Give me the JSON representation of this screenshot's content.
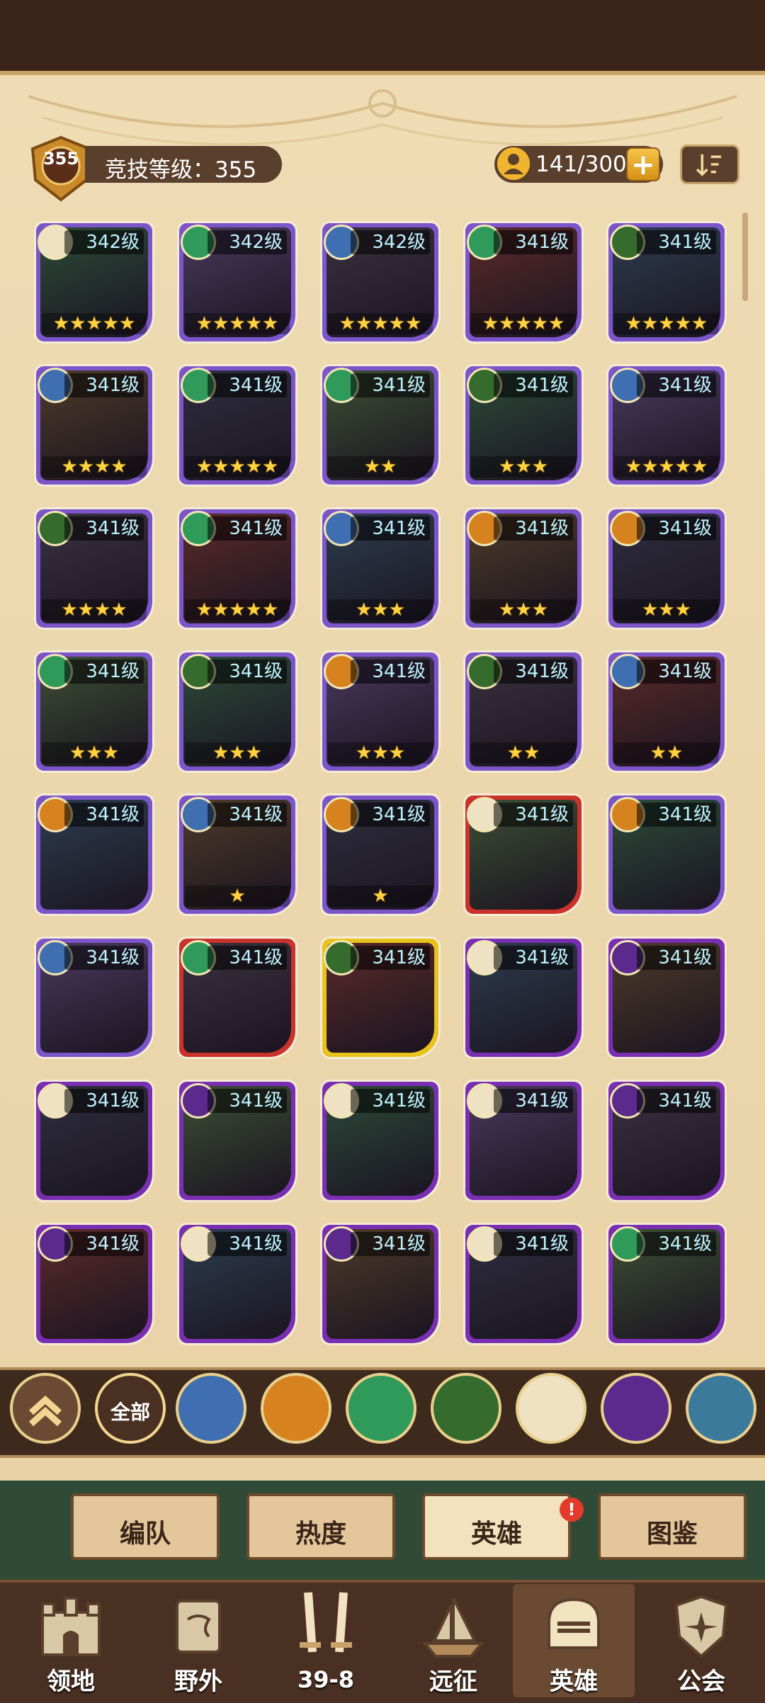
{
  "header": {
    "rank_badge": "355",
    "arena_label": "竞技等级：355",
    "hero_count": "141/300",
    "plus_label": "+"
  },
  "heroes": [
    {
      "level": "342级",
      "stars": "★★★★★",
      "frame": "purple",
      "faction": "celestial"
    },
    {
      "level": "342级",
      "stars": "★★★★★",
      "frame": "purple",
      "faction": "wilder"
    },
    {
      "level": "342级",
      "stars": "★★★★★",
      "frame": "purple",
      "faction": "lightbearer"
    },
    {
      "level": "341级",
      "stars": "★★★★★",
      "frame": "purple",
      "faction": "wilder"
    },
    {
      "level": "341级",
      "stars": "★★★★★",
      "frame": "purple",
      "faction": "graveborn"
    },
    {
      "level": "341级",
      "stars": "★★★★",
      "frame": "purple",
      "faction": "lightbearer"
    },
    {
      "level": "341级",
      "stars": "★★★★★",
      "frame": "purple",
      "faction": "wilder"
    },
    {
      "level": "341级",
      "stars": "★★",
      "frame": "purple",
      "faction": "wilder"
    },
    {
      "level": "341级",
      "stars": "★★★",
      "frame": "purple",
      "faction": "graveborn"
    },
    {
      "level": "341级",
      "stars": "★★★★★",
      "frame": "purple",
      "faction": "lightbearer"
    },
    {
      "level": "341级",
      "stars": "★★★★",
      "frame": "purple",
      "faction": "graveborn"
    },
    {
      "level": "341级",
      "stars": "★★★★★",
      "frame": "purple",
      "faction": "wilder"
    },
    {
      "level": "341级",
      "stars": "★★★",
      "frame": "purple",
      "faction": "lightbearer"
    },
    {
      "level": "341级",
      "stars": "★★★",
      "frame": "purple",
      "faction": "mauler"
    },
    {
      "level": "341级",
      "stars": "★★★",
      "frame": "purple",
      "faction": "mauler"
    },
    {
      "level": "341级",
      "stars": "★★★",
      "frame": "purple",
      "faction": "wilder"
    },
    {
      "level": "341级",
      "stars": "★★★",
      "frame": "purple",
      "faction": "graveborn"
    },
    {
      "level": "341级",
      "stars": "★★★",
      "frame": "purple",
      "faction": "mauler"
    },
    {
      "level": "341级",
      "stars": "★★",
      "frame": "purple",
      "faction": "graveborn"
    },
    {
      "level": "341级",
      "stars": "★★",
      "frame": "purple",
      "faction": "lightbearer"
    },
    {
      "level": "341级",
      "stars": "",
      "frame": "purple",
      "faction": "mauler"
    },
    {
      "level": "341级",
      "stars": "★",
      "frame": "purple",
      "faction": "lightbearer"
    },
    {
      "level": "341级",
      "stars": "★",
      "frame": "purple",
      "faction": "mauler"
    },
    {
      "level": "341级",
      "stars": "",
      "frame": "red",
      "faction": "celestial"
    },
    {
      "level": "341级",
      "stars": "",
      "frame": "purple",
      "faction": "mauler"
    },
    {
      "level": "341级",
      "stars": "",
      "frame": "purple",
      "faction": "lightbearer"
    },
    {
      "level": "341级",
      "stars": "",
      "frame": "red",
      "faction": "wilder"
    },
    {
      "level": "341级",
      "stars": "",
      "frame": "yellow",
      "faction": "graveborn"
    },
    {
      "level": "341级",
      "stars": "",
      "frame": "violet",
      "faction": "celestial"
    },
    {
      "level": "341级",
      "stars": "",
      "frame": "violet",
      "faction": "hypogean"
    },
    {
      "level": "341级",
      "stars": "",
      "frame": "violet",
      "faction": "celestial"
    },
    {
      "level": "341级",
      "stars": "",
      "frame": "violet",
      "faction": "hypogean"
    },
    {
      "level": "341级",
      "stars": "",
      "frame": "violet",
      "faction": "celestial"
    },
    {
      "level": "341级",
      "stars": "",
      "frame": "violet",
      "faction": "celestial"
    },
    {
      "level": "341级",
      "stars": "",
      "frame": "violet",
      "faction": "hypogean"
    },
    {
      "level": "341级",
      "stars": "",
      "frame": "violet",
      "faction": "hypogean"
    },
    {
      "level": "341级",
      "stars": "",
      "frame": "violet",
      "faction": "celestial"
    },
    {
      "level": "341级",
      "stars": "",
      "frame": "violet",
      "faction": "hypogean"
    },
    {
      "level": "341级",
      "stars": "",
      "frame": "violet",
      "faction": "celestial"
    },
    {
      "level": "341级",
      "stars": "",
      "frame": "violet",
      "faction": "wilder"
    }
  ],
  "filters": {
    "collapse_icon": "double-chevron-up-icon",
    "all_label": "全部",
    "factions": [
      "lightbearer",
      "mauler",
      "wilder",
      "graveborn",
      "celestial",
      "hypogean",
      "dimensional"
    ]
  },
  "tabs": [
    {
      "label": "编队"
    },
    {
      "label": "热度"
    },
    {
      "label": "英雄",
      "alert": "!"
    },
    {
      "label": "图鉴"
    }
  ],
  "nav": [
    {
      "label": "领地",
      "icon": "castle-icon"
    },
    {
      "label": "野外",
      "icon": "scroll-map-icon"
    },
    {
      "label": "39-8",
      "icon": "crossed-swords-icon"
    },
    {
      "label": "远征",
      "icon": "ship-icon"
    },
    {
      "label": "英雄",
      "icon": "helmet-icon"
    },
    {
      "label": "公会",
      "icon": "guild-shield-icon"
    }
  ],
  "colors": {
    "frame_purple": "#7b55c9",
    "frame_red": "#c9332b",
    "frame_yellow": "#e9c21c",
    "frame_violet": "#7a2fb3",
    "lightbearer": "#3f6fb0",
    "mauler": "#d6821e",
    "wilder": "#2f9a5a",
    "graveborn": "#356b2c",
    "celestial": "#efe2c2",
    "hypogean": "#5b2a8c",
    "dimensional": "#3c7a9c"
  }
}
